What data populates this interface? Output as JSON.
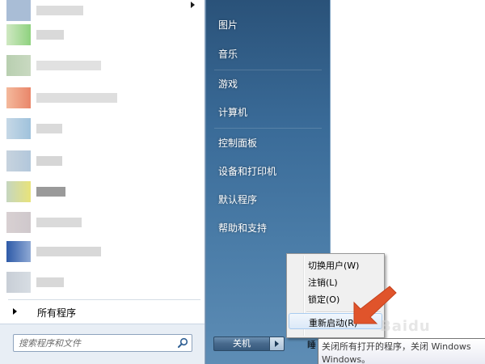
{
  "start_menu": {
    "left_pane": {
      "all_programs_label": "所有程序",
      "search_placeholder": "搜索程序和文件"
    },
    "right_pane": {
      "items": [
        {
          "label": "图片"
        },
        {
          "label": "音乐"
        },
        {
          "label": "游戏"
        },
        {
          "label": "计算机"
        },
        {
          "label": "控制面板"
        },
        {
          "label": "设备和打印机"
        },
        {
          "label": "默认程序"
        },
        {
          "label": "帮助和支持"
        }
      ],
      "shutdown_label": "关机"
    },
    "power_menu": {
      "items": [
        {
          "label": "切换用户(W)"
        },
        {
          "label": "注销(L)"
        },
        {
          "label": "锁定(O)"
        },
        {
          "label": "重新启动(R)"
        }
      ],
      "hidden_item_partial": "睡"
    },
    "tooltip": {
      "line1": "关闭所有打开的程序，关闭 Windows",
      "line2": "Windows。"
    }
  },
  "colors": {
    "right_pane_top": "#2a5279",
    "right_pane_bottom": "#5e8db5",
    "highlight_border": "#a8cbef",
    "arrow": "#e0542b"
  },
  "icons": {
    "search": "magnifier-icon",
    "arrow": "orange-pointer-arrow-icon"
  },
  "watermark": "Baidu"
}
